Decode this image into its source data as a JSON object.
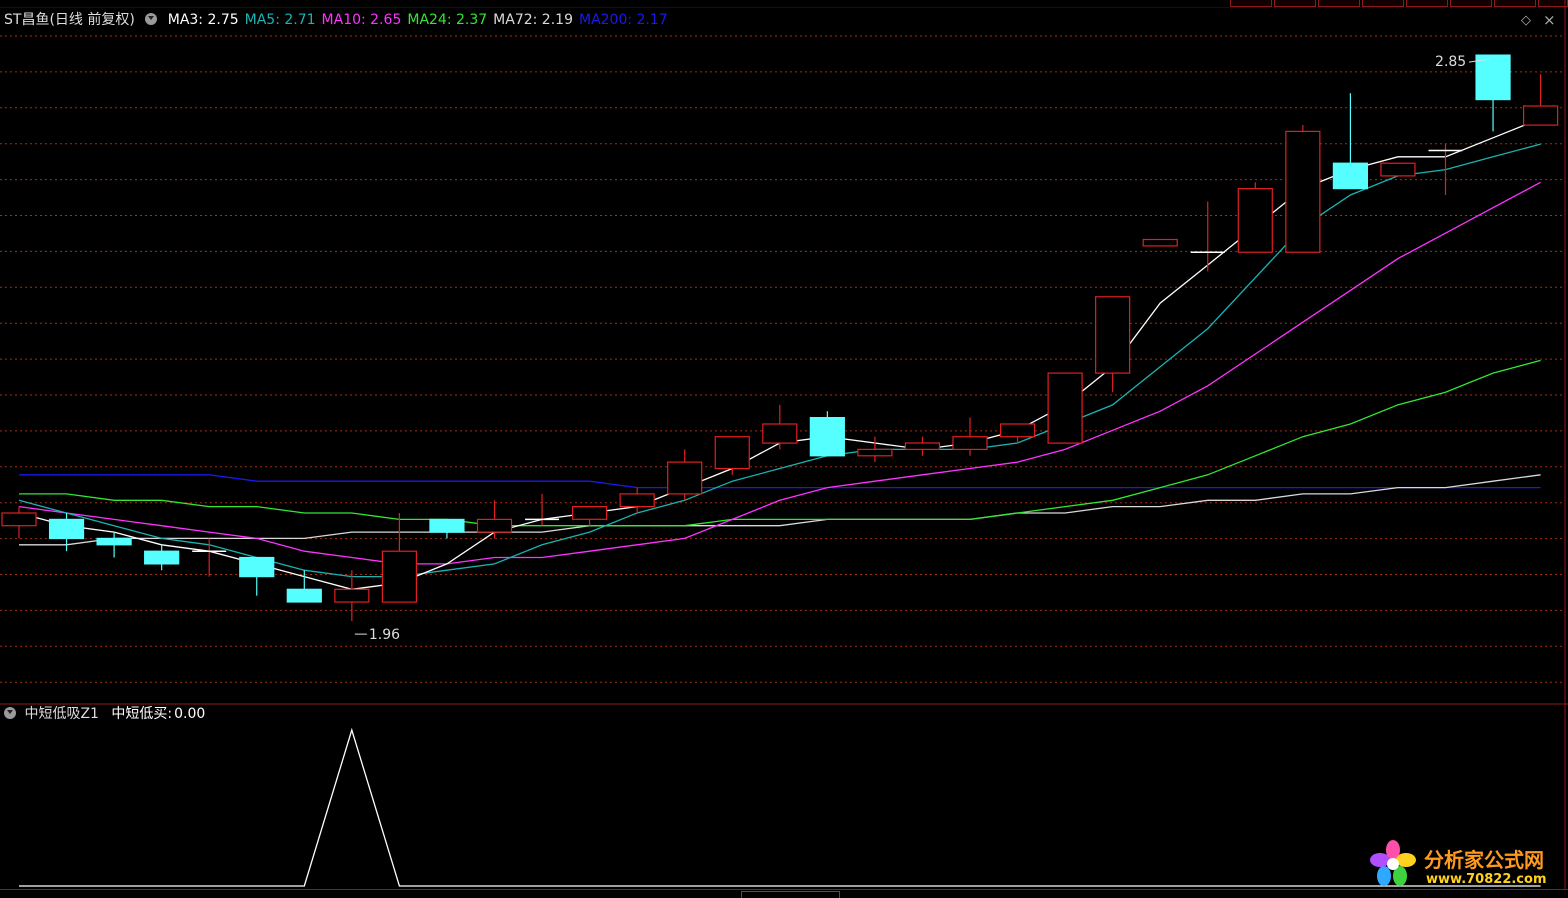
{
  "stock": {
    "name": "ST昌鱼",
    "period": "(日线 前复权)"
  },
  "ma_legend": [
    {
      "label": "MA3: 2.75",
      "color": "#ffffff"
    },
    {
      "label": "MA5: 2.71",
      "color": "#1ab3b3"
    },
    {
      "label": "MA10: 2.65",
      "color": "#ff33ff"
    },
    {
      "label": "MA24: 2.37",
      "color": "#33e633"
    },
    {
      "label": "MA72: 2.19",
      "color": "#d9d9d9"
    },
    {
      "label": "MA200: 2.17",
      "color": "#1a1ae6"
    }
  ],
  "indicator": {
    "name": "中短低吸Z1",
    "value_label": "中短低买:",
    "value": "0.00"
  },
  "watermark": {
    "name": "分析家公式网",
    "url": "www.70822.com"
  },
  "colors": {
    "up": "#e02020",
    "down": "#55ffff",
    "grid": "#a0300f",
    "background": "#000000"
  },
  "chart_data": [
    {
      "type": "candlestick",
      "y_range": [
        1.88,
        2.88
      ],
      "annotations": [
        {
          "text": "2.85",
          "candle_index": 31,
          "kind": "high"
        },
        {
          "text": "1.96",
          "candle_index": 7,
          "kind": "low"
        }
      ],
      "candles": [
        {
          "o": 2.11,
          "h": 2.14,
          "l": 2.09,
          "c": 2.13
        },
        {
          "o": 2.12,
          "h": 2.13,
          "l": 2.07,
          "c": 2.09
        },
        {
          "o": 2.09,
          "h": 2.1,
          "l": 2.06,
          "c": 2.08
        },
        {
          "o": 2.07,
          "h": 2.08,
          "l": 2.04,
          "c": 2.05
        },
        {
          "o": 2.07,
          "h": 2.09,
          "l": 2.03,
          "c": 2.07
        },
        {
          "o": 2.06,
          "h": 2.06,
          "l": 2.0,
          "c": 2.03
        },
        {
          "o": 2.01,
          "h": 2.04,
          "l": 1.99,
          "c": 1.99
        },
        {
          "o": 1.99,
          "h": 2.04,
          "l": 1.96,
          "c": 2.01
        },
        {
          "o": 1.99,
          "h": 2.13,
          "l": 1.99,
          "c": 2.07
        },
        {
          "o": 2.12,
          "h": 2.12,
          "l": 2.09,
          "c": 2.1
        },
        {
          "o": 2.1,
          "h": 2.15,
          "l": 2.09,
          "c": 2.12
        },
        {
          "o": 2.12,
          "h": 2.16,
          "l": 2.11,
          "c": 2.12
        },
        {
          "o": 2.12,
          "h": 2.14,
          "l": 2.11,
          "c": 2.14
        },
        {
          "o": 2.14,
          "h": 2.17,
          "l": 2.13,
          "c": 2.16
        },
        {
          "o": 2.16,
          "h": 2.23,
          "l": 2.15,
          "c": 2.21
        },
        {
          "o": 2.2,
          "h": 2.25,
          "l": 2.19,
          "c": 2.25
        },
        {
          "o": 2.24,
          "h": 2.3,
          "l": 2.23,
          "c": 2.27
        },
        {
          "o": 2.28,
          "h": 2.29,
          "l": 2.24,
          "c": 2.22
        },
        {
          "o": 2.22,
          "h": 2.25,
          "l": 2.21,
          "c": 2.23
        },
        {
          "o": 2.23,
          "h": 2.25,
          "l": 2.22,
          "c": 2.24
        },
        {
          "o": 2.23,
          "h": 2.28,
          "l": 2.22,
          "c": 2.25
        },
        {
          "o": 2.25,
          "h": 2.27,
          "l": 2.24,
          "c": 2.27
        },
        {
          "o": 2.24,
          "h": 2.35,
          "l": 2.24,
          "c": 2.35
        },
        {
          "o": 2.35,
          "h": 2.47,
          "l": 2.32,
          "c": 2.47
        },
        {
          "o": 2.55,
          "h": 2.56,
          "l": 2.55,
          "c": 2.56
        },
        {
          "o": 2.54,
          "h": 2.62,
          "l": 2.51,
          "c": 2.54
        },
        {
          "o": 2.54,
          "h": 2.65,
          "l": 2.54,
          "c": 2.64
        },
        {
          "o": 2.54,
          "h": 2.74,
          "l": 2.54,
          "c": 2.73
        },
        {
          "o": 2.68,
          "h": 2.79,
          "l": 2.64,
          "c": 2.64
        },
        {
          "o": 2.66,
          "h": 2.68,
          "l": 2.66,
          "c": 2.68
        },
        {
          "o": 2.7,
          "h": 2.71,
          "l": 2.63,
          "c": 2.7
        },
        {
          "o": 2.85,
          "h": 2.85,
          "l": 2.73,
          "c": 2.78
        },
        {
          "o": 2.74,
          "h": 2.82,
          "l": 2.74,
          "c": 2.77
        }
      ],
      "ma_lines": {
        "MA3": [
          2.13,
          2.11,
          2.1,
          2.08,
          2.07,
          2.05,
          2.03,
          2.01,
          2.02,
          2.05,
          2.1,
          2.12,
          2.13,
          2.14,
          2.17,
          2.2,
          2.24,
          2.25,
          2.24,
          2.23,
          2.24,
          2.26,
          2.3,
          2.36,
          2.46,
          2.52,
          2.58,
          2.64,
          2.67,
          2.69,
          2.69,
          2.72,
          2.75
        ],
        "MA5": [
          2.15,
          2.13,
          2.11,
          2.09,
          2.08,
          2.06,
          2.04,
          2.03,
          2.03,
          2.04,
          2.05,
          2.08,
          2.1,
          2.13,
          2.15,
          2.18,
          2.2,
          2.22,
          2.23,
          2.23,
          2.23,
          2.24,
          2.27,
          2.3,
          2.36,
          2.42,
          2.5,
          2.58,
          2.63,
          2.66,
          2.67,
          2.69,
          2.71
        ],
        "MA10": [
          2.14,
          2.13,
          2.12,
          2.11,
          2.1,
          2.09,
          2.07,
          2.06,
          2.05,
          2.05,
          2.06,
          2.06,
          2.07,
          2.08,
          2.09,
          2.12,
          2.15,
          2.17,
          2.18,
          2.19,
          2.2,
          2.21,
          2.23,
          2.26,
          2.29,
          2.33,
          2.38,
          2.43,
          2.48,
          2.53,
          2.57,
          2.61,
          2.65
        ],
        "MA24": [
          2.16,
          2.16,
          2.15,
          2.15,
          2.14,
          2.14,
          2.13,
          2.13,
          2.12,
          2.12,
          2.11,
          2.11,
          2.11,
          2.11,
          2.11,
          2.12,
          2.12,
          2.12,
          2.12,
          2.12,
          2.12,
          2.13,
          2.14,
          2.15,
          2.17,
          2.19,
          2.22,
          2.25,
          2.27,
          2.3,
          2.32,
          2.35,
          2.37
        ],
        "MA72": [
          2.08,
          2.08,
          2.09,
          2.09,
          2.09,
          2.09,
          2.09,
          2.1,
          2.1,
          2.1,
          2.1,
          2.1,
          2.11,
          2.11,
          2.11,
          2.11,
          2.11,
          2.12,
          2.12,
          2.12,
          2.12,
          2.13,
          2.13,
          2.14,
          2.14,
          2.15,
          2.15,
          2.16,
          2.16,
          2.17,
          2.17,
          2.18,
          2.19
        ],
        "MA200": [
          2.19,
          2.19,
          2.19,
          2.19,
          2.19,
          2.18,
          2.18,
          2.18,
          2.18,
          2.18,
          2.18,
          2.18,
          2.18,
          2.17,
          2.17,
          2.17,
          2.17,
          2.17,
          2.17,
          2.17,
          2.17,
          2.17,
          2.17,
          2.17,
          2.17,
          2.17,
          2.17,
          2.17,
          2.17,
          2.17,
          2.17,
          2.17,
          2.17
        ]
      }
    },
    {
      "type": "line",
      "name": "中短低买",
      "y_range": [
        0,
        1
      ],
      "values": [
        0,
        0,
        0,
        0,
        0,
        0,
        0,
        1,
        0,
        0,
        0,
        0,
        0,
        0,
        0,
        0,
        0,
        0,
        0,
        0,
        0,
        0,
        0,
        0,
        0,
        0,
        0,
        0,
        0,
        0,
        0,
        0,
        0
      ]
    }
  ]
}
